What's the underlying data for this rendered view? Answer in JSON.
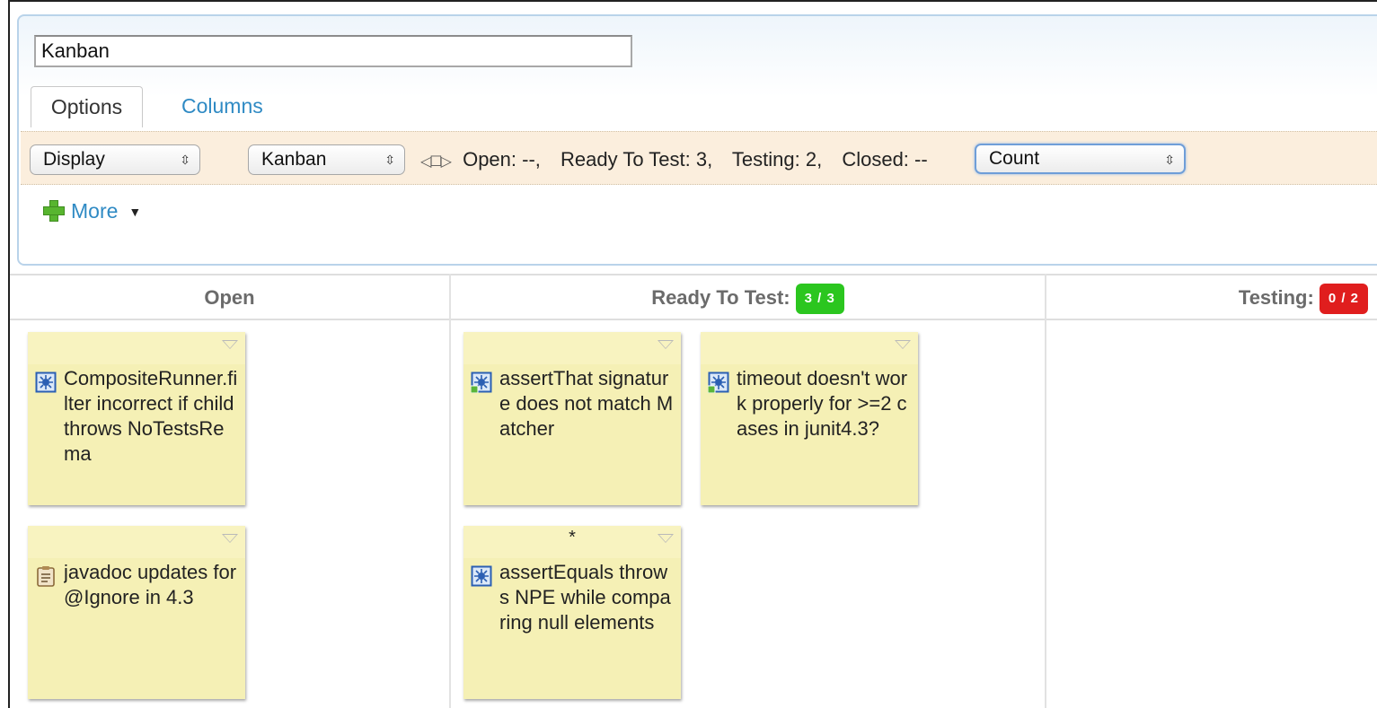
{
  "editor": {
    "title_value": "Kanban",
    "tabs": [
      {
        "label": "Options",
        "active": true
      },
      {
        "label": "Columns",
        "active": false
      }
    ],
    "toolbar": {
      "group_select": "Display",
      "layout_select": "Kanban",
      "column_counts": [
        "Open: --,",
        "Ready To Test: 3,",
        "Testing: 2,",
        "Closed: --"
      ],
      "aggregate_select": "Count"
    },
    "more_label": "More"
  },
  "board": {
    "columns": [
      {
        "title": "Open",
        "badge": null
      },
      {
        "title": "Ready To Test:",
        "badge": "3 / 3",
        "badge_color": "#2bc61f"
      },
      {
        "title": "Testing:",
        "badge": "0 / 2",
        "badge_color": "#e01e1e"
      }
    ],
    "cards": {
      "open_1": {
        "icon": "defect-icon",
        "text": "CompositeRunner.filter incorrect if child throws NoTestsRema"
      },
      "open_2": {
        "icon": "task-icon",
        "text": "javadoc updates for @Ignore in 4.3"
      },
      "rtt_1": {
        "icon": "defect-icon",
        "text": "assertThat signature does not match Matcher"
      },
      "rtt_2": {
        "icon": "defect-icon",
        "text": "timeout doesn't work properly for >=2 cases in junit4.3?"
      },
      "rtt_3": {
        "icon": "defect-icon",
        "text": "assertEquals throws NPE while comparing null elements",
        "marker": "*"
      }
    }
  },
  "colors": {
    "link": "#2f8ac4",
    "toolbar_bg": "#fbeedd",
    "card_bg": "#f5f0b5",
    "badge_ok": "#2bc61f",
    "badge_over": "#e01e1e"
  }
}
